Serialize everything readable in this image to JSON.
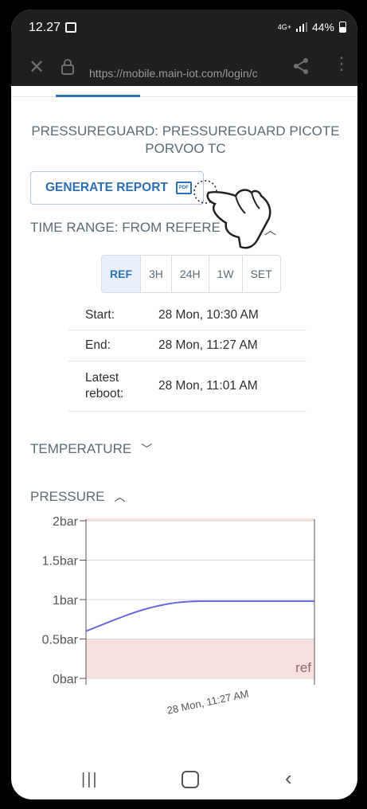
{
  "status": {
    "time": "12.27",
    "network": "4G+",
    "battery": "44%"
  },
  "browser": {
    "url": "https://mobile.main-iot.com/login/c"
  },
  "page": {
    "title": "PRESSUREGUARD: PRESSUREGUARD PICOTE PORVOO TC",
    "generate_report": "GENERATE REPORT",
    "pdf_label": "PDF",
    "time_range_header": "TIME RANGE: FROM REFERE",
    "range_buttons": [
      "REF",
      "3H",
      "24H",
      "1W",
      "SET"
    ],
    "selected_range": "REF",
    "info": {
      "start_label": "Start:",
      "start_value": "28 Mon, 10:30 AM",
      "end_label": "End:",
      "end_value": "28 Mon, 11:27 AM",
      "reboot_label": "Latest reboot:",
      "reboot_value": "28 Mon, 11:01 AM"
    },
    "temperature_header": "TEMPERATURE",
    "pressure_header": "PRESSURE"
  },
  "chart_data": {
    "type": "line",
    "y_ticks": [
      "0bar",
      "0.5bar",
      "1bar",
      "1.5bar",
      "2bar"
    ],
    "ylim": [
      0,
      2
    ],
    "x_tick": "28 Mon, 11:27 AM",
    "annotation": "ref",
    "series": [
      {
        "x": [
          0,
          0.25,
          0.5,
          1
        ],
        "values": [
          0.6,
          0.85,
          0.98,
          0.98
        ],
        "color": "#6a6ae0"
      }
    ],
    "bands": [
      {
        "from": 0,
        "to": 0.5,
        "color": "#fbe0e0"
      },
      {
        "from": 2,
        "to": 2.03,
        "color": "#fbe0e0"
      }
    ]
  },
  "colors": {
    "accent": "#2d73b8",
    "header_bg": "#1f1f1f"
  }
}
